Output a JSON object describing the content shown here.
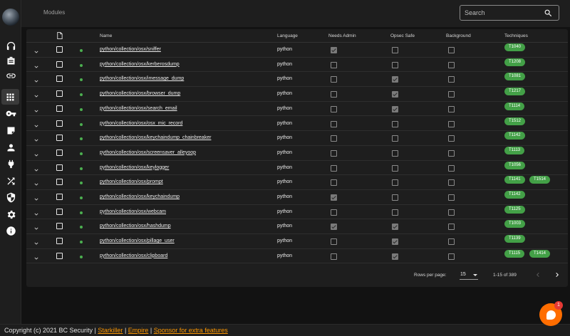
{
  "app": {
    "page_title": "Modules"
  },
  "search": {
    "placeholder": "Search"
  },
  "nav": [
    "headphones-icon",
    "briefcase-icon",
    "link-icon",
    "grid-icon",
    "key-icon",
    "note-icon",
    "user-icon",
    "plug-icon",
    "shuffle-icon",
    "shield-icon",
    "gear-icon",
    "info-icon"
  ],
  "table": {
    "headers": {
      "name": "Name",
      "language": "Language",
      "needs_admin": "Needs Admin",
      "opsec_safe": "Opsec Safe",
      "background": "Background",
      "techniques": "Techniques"
    },
    "rows": [
      {
        "name": "python/collection/osx/sniffer",
        "language": "python",
        "needs_admin": true,
        "opsec_safe": false,
        "background": false,
        "techniques": [
          "T1040"
        ]
      },
      {
        "name": "python/collection/osx/kerberosdump",
        "language": "python",
        "needs_admin": false,
        "opsec_safe": false,
        "background": false,
        "techniques": [
          "T1208"
        ]
      },
      {
        "name": "python/collection/osx/imessage_dump",
        "language": "python",
        "needs_admin": false,
        "opsec_safe": true,
        "background": false,
        "techniques": [
          "T1081"
        ]
      },
      {
        "name": "python/collection/osx/browser_dump",
        "language": "python",
        "needs_admin": false,
        "opsec_safe": true,
        "background": false,
        "techniques": [
          "T1217"
        ]
      },
      {
        "name": "python/collection/osx/search_email",
        "language": "python",
        "needs_admin": false,
        "opsec_safe": true,
        "background": false,
        "techniques": [
          "T1114"
        ]
      },
      {
        "name": "python/collection/osx/osx_mic_record",
        "language": "python",
        "needs_admin": false,
        "opsec_safe": false,
        "background": false,
        "techniques": [
          "T1512"
        ]
      },
      {
        "name": "python/collection/osx/keychaindump_chainbreaker",
        "language": "python",
        "needs_admin": false,
        "opsec_safe": false,
        "background": false,
        "techniques": [
          "T1142"
        ]
      },
      {
        "name": "python/collection/osx/screensaver_alleyoop",
        "language": "python",
        "needs_admin": false,
        "opsec_safe": false,
        "background": false,
        "techniques": [
          "T1113"
        ]
      },
      {
        "name": "python/collection/osx/keylogger",
        "language": "python",
        "needs_admin": false,
        "opsec_safe": false,
        "background": false,
        "techniques": [
          "T1056"
        ]
      },
      {
        "name": "python/collection/osx/prompt",
        "language": "python",
        "needs_admin": false,
        "opsec_safe": false,
        "background": false,
        "techniques": [
          "T1141",
          "T1514"
        ]
      },
      {
        "name": "python/collection/osx/keychaindump",
        "language": "python",
        "needs_admin": true,
        "opsec_safe": false,
        "background": false,
        "techniques": [
          "T1142"
        ]
      },
      {
        "name": "python/collection/osx/webcam",
        "language": "python",
        "needs_admin": false,
        "opsec_safe": false,
        "background": false,
        "techniques": [
          "T1125"
        ]
      },
      {
        "name": "python/collection/osx/hashdump",
        "language": "python",
        "needs_admin": true,
        "opsec_safe": true,
        "background": false,
        "techniques": [
          "T1003"
        ]
      },
      {
        "name": "python/collection/osx/pillage_user",
        "language": "python",
        "needs_admin": false,
        "opsec_safe": true,
        "background": false,
        "techniques": [
          "T1139"
        ]
      },
      {
        "name": "python/collection/osx/clipboard",
        "language": "python",
        "needs_admin": false,
        "opsec_safe": true,
        "background": false,
        "techniques": [
          "T1115",
          "T1414"
        ]
      }
    ]
  },
  "pagination": {
    "rows_per_page_label": "Rows per page:",
    "rows_per_page": "15",
    "range": "1-15 of 389"
  },
  "footer": {
    "copyright": "Copyright (c) 2021 BC Security |",
    "link1": "Starkiller",
    "link2": "Empire",
    "link3": "Sponsor for extra features",
    "sep": "|"
  },
  "chat": {
    "badge": "1"
  },
  "colors": {
    "accent_green": "#43a047",
    "link_orange": "#ff9800",
    "fab_orange": "#ff6d00"
  }
}
